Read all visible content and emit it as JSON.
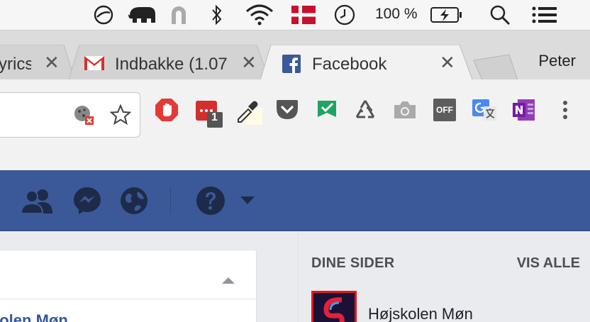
{
  "menubar": {
    "battery_percent": "100 %",
    "flag_color": "#c8102e",
    "icons": [
      "do-not-disturb-icon",
      "evernote-elephant-icon",
      "magnet-icon",
      "bluetooth-icon",
      "wifi-icon",
      "danish-flag-icon",
      "time-machine-icon",
      "battery-charging-icon",
      "spotlight-search-icon",
      "notification-center-icon"
    ]
  },
  "tabs": [
    {
      "title": "yrics",
      "icon": "lyrics-tab"
    },
    {
      "title": "Indbakke (1.07",
      "icon": "gmail-icon"
    },
    {
      "title": "Facebook",
      "icon": "facebook-icon",
      "active": true
    }
  ],
  "profile": {
    "name": "Peter"
  },
  "toolbar": {
    "extensions": [
      "block-cookies-icon",
      "star-bookmark-icon",
      "adblock-icon",
      "sync-extension-icon",
      "eyedropper-icon",
      "pocket-icon",
      "todoist-check-icon",
      "recycle-icon",
      "camera-icon",
      "off-toggle-icon",
      "google-translate-icon",
      "onenote-icon",
      "chrome-menu-icon"
    ],
    "badge_count": "1",
    "off_label": "OFF"
  },
  "fbbar": {
    "icons": [
      "friend-requests-icon",
      "messenger-icon",
      "notifications-globe-icon",
      "help-question-icon",
      "dropdown-caret-icon"
    ],
    "color": "#3b5998"
  },
  "feed": {
    "link_text": "kolen Møn"
  },
  "pages": {
    "heading": "DINE SIDER",
    "see_all": "VIS ALLE",
    "items": [
      {
        "name": "Højskolen Møn"
      }
    ]
  }
}
